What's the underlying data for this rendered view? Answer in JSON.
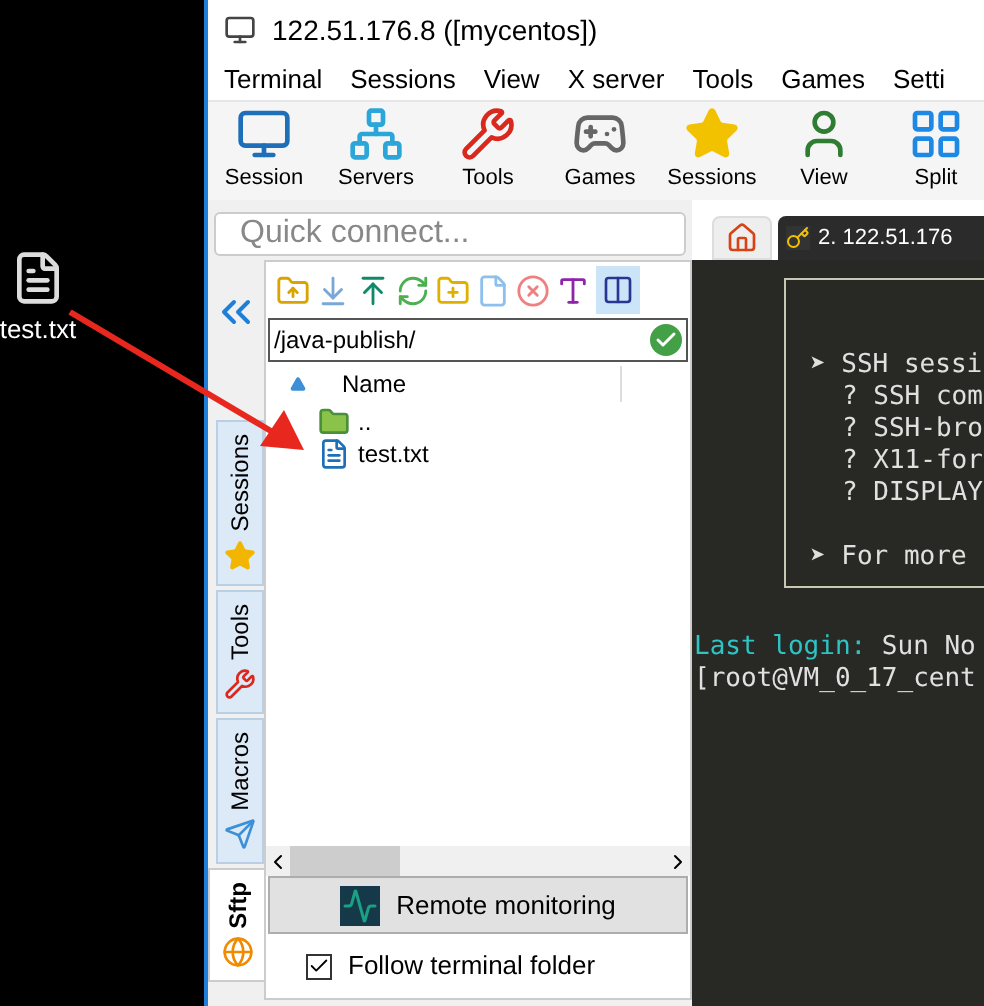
{
  "desktop": {
    "file_label": "test.txt"
  },
  "window": {
    "title": "122.51.176.8 ([mycentos])"
  },
  "menu": [
    "Terminal",
    "Sessions",
    "View",
    "X server",
    "Tools",
    "Games",
    "Setti"
  ],
  "toolbar": [
    {
      "kind": "session",
      "label": "Session"
    },
    {
      "kind": "servers",
      "label": "Servers"
    },
    {
      "kind": "tools",
      "label": "Tools"
    },
    {
      "kind": "games",
      "label": "Games"
    },
    {
      "kind": "sessions",
      "label": "Sessions"
    },
    {
      "kind": "view",
      "label": "View"
    },
    {
      "kind": "split",
      "label": "Split"
    }
  ],
  "quick_connect": {
    "placeholder": "Quick connect..."
  },
  "side_tabs": [
    {
      "kind": "sessions",
      "label": "Sessions",
      "selected": false
    },
    {
      "kind": "tools",
      "label": "Tools",
      "selected": false
    },
    {
      "kind": "macros",
      "label": "Macros",
      "selected": false
    },
    {
      "kind": "sftp",
      "label": "Sftp",
      "selected": true
    }
  ],
  "sftp": {
    "path": "/java-publish/",
    "columns": [
      "Name"
    ],
    "files": [
      {
        "kind": "parent",
        "name": ".."
      },
      {
        "kind": "file",
        "name": "test.txt"
      }
    ],
    "remote_monitoring": "Remote monitoring",
    "follow_terminal_folder": {
      "label": "Follow terminal folder",
      "checked": true
    }
  },
  "terminal": {
    "tabs": [
      {
        "kind": "home",
        "selected": false
      },
      {
        "kind": "session",
        "label": "2. 122.51.176",
        "selected": true
      }
    ],
    "banner": [
      {
        "kind": "heading",
        "text": "➤ SSH sessi"
      },
      {
        "kind": "item",
        "text": "? SSH com"
      },
      {
        "kind": "item",
        "text": "? SSH-bro"
      },
      {
        "kind": "item",
        "text": "? X11-for"
      },
      {
        "kind": "item",
        "text": "? DISPLAY"
      },
      {
        "kind": "heading",
        "text": "➤ For more"
      }
    ],
    "login_label": "Last login:",
    "login_value": "Sun No",
    "prompt": "[root@VM_0_17_cent"
  }
}
